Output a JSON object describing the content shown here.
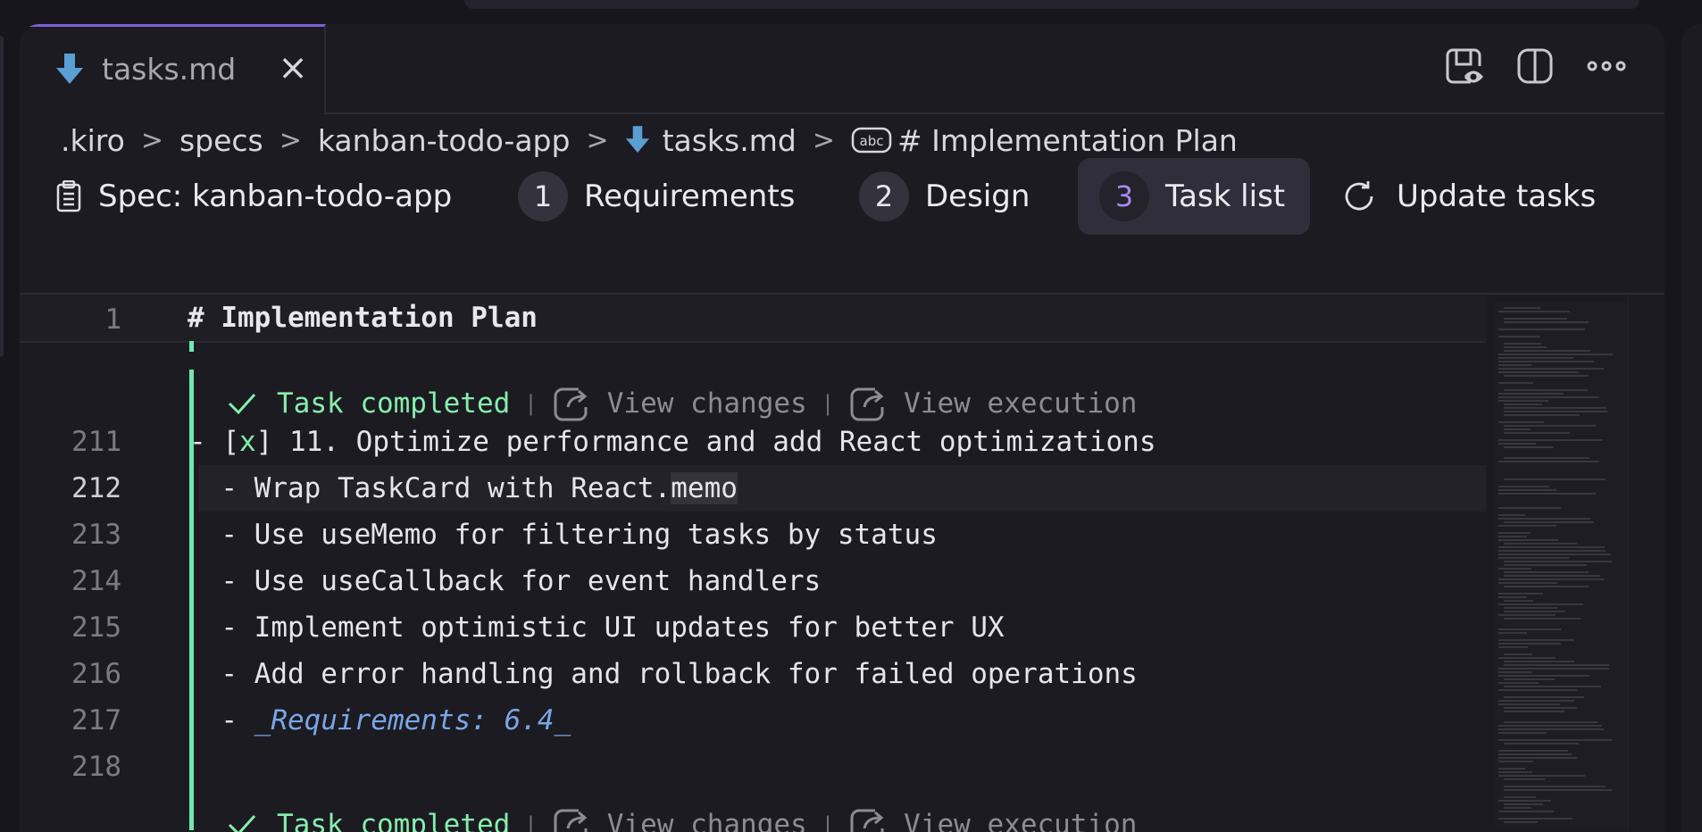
{
  "tab": {
    "label": "tasks.md",
    "close_glyph": "×"
  },
  "breadcrumb": {
    "items": [
      ".kiro",
      "specs",
      "kanban-todo-app",
      "tasks.md",
      "# Implementation Plan"
    ],
    "separator": ">"
  },
  "spec_bar": {
    "spec_label": "Spec: kanban-todo-app",
    "steps": [
      {
        "num": "1",
        "label": "Requirements"
      },
      {
        "num": "2",
        "label": "Design"
      },
      {
        "num": "3",
        "label": "Task list"
      }
    ],
    "update_label": "Update tasks"
  },
  "editor": {
    "sticky_line": {
      "num": "1",
      "text": "# Implementation Plan"
    },
    "codelens": {
      "status": "Task completed",
      "separator": "|",
      "view_changes": "View changes",
      "view_execution": "View execution"
    },
    "lines": [
      {
        "num": "211",
        "prefix": "- [",
        "check": "x",
        "suffix": "] 11. Optimize performance and add React optimizations"
      },
      {
        "num": "212",
        "pre": "  - Wrap TaskCard with React.",
        "hl": "memo"
      },
      {
        "num": "213",
        "text": "  - Use useMemo for filtering tasks by status"
      },
      {
        "num": "214",
        "text": "  - Use useCallback for event handlers"
      },
      {
        "num": "215",
        "text": "  - Implement optimistic UI updates for better UX"
      },
      {
        "num": "216",
        "text": "  - Add error handling and rollback for failed operations"
      },
      {
        "num": "217",
        "pre": "  - ",
        "req": "_Requirements: 6.4_"
      },
      {
        "num": "218",
        "text": ""
      }
    ],
    "next_codelens": {
      "status": "Task completed",
      "view_changes": "View changes",
      "view_execution": "View execution"
    }
  },
  "colors": {
    "accent": "#7d63d6",
    "active_step": "#a58bf0",
    "done_green": "#86efac",
    "req_blue": "#7aa6e6"
  },
  "icons": {
    "tab": "markdown-down-arrow-icon",
    "spec": "clipboard-icon",
    "update": "refresh-icon",
    "actions": [
      "preview-icon",
      "split-editor-icon",
      "more-icon"
    ]
  }
}
